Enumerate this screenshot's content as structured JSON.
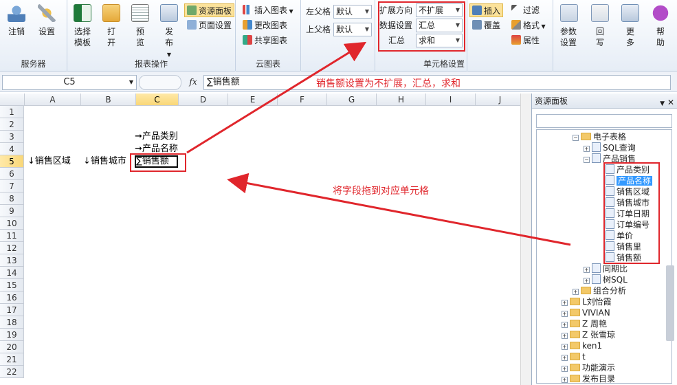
{
  "ribbon": {
    "groups": {
      "service": "服务器",
      "report_ops": "报表操作",
      "cloud": "云图表",
      "cell_settings": "单元格设置"
    },
    "cancel": "注销",
    "settings": "设置",
    "select_template": "选择模板",
    "open": "打开",
    "preview": "预览",
    "publish": "发布",
    "resource_panel": "资源面板",
    "page_setup": "页面设置",
    "insert_chart": "插入图表",
    "change_chart": "更改图表",
    "share_chart": "共享图表",
    "left_parent_label": "左父格",
    "left_parent_value": "默认",
    "top_parent_label": "上父格",
    "top_parent_value": "默认",
    "expand_dir_label": "扩展方向",
    "expand_dir_value": "不扩展",
    "data_setting_label": "数据设置",
    "data_setting_value": "汇总",
    "agg_label": "汇总",
    "agg_value": "求和",
    "insert": "插入",
    "cover": "覆盖",
    "filter": "过滤",
    "format": "格式",
    "property": "属性",
    "param_settings": "参数设置",
    "fill": "回写",
    "more": "更多",
    "help": "帮助"
  },
  "formula_bar": {
    "cell_ref": "C5",
    "fx": "fx",
    "formula": "∑销售额",
    "annotation": "销售额设置为不扩展，汇总，求和"
  },
  "sheet": {
    "columns": [
      "A",
      "B",
      "C",
      "D",
      "E",
      "F",
      "G",
      "H",
      "I",
      "J"
    ],
    "rows": [
      "1",
      "2",
      "3",
      "4",
      "5",
      "6",
      "7",
      "8",
      "9",
      "10",
      "11",
      "12",
      "13",
      "14",
      "15",
      "16",
      "17",
      "18",
      "19",
      "20",
      "21",
      "22"
    ],
    "c3": "➞产品类别",
    "c4": "➞产品名称",
    "a5": "↓销售区域",
    "b5": "↓销售城市",
    "c5": "∑销售额",
    "drag_annotation": "将字段拖到对应单元格"
  },
  "resource_panel": {
    "title": "资源面板",
    "tree": {
      "spreadsheet": "电子表格",
      "sql_query": "SQL查询",
      "product_sales": "产品销售",
      "fields": [
        "产品类别",
        "产品名称",
        "销售区域",
        "销售城市",
        "订单日期",
        "订单编号",
        "单价",
        "销售里",
        "销售额"
      ],
      "same_period": "同期比",
      "tree_sql": "树SQL",
      "combo_analysis": "组合分析",
      "folders": [
        "L刘怡霞",
        "VIVIAN",
        "Z 周艳",
        "Z 张雪琼",
        "ken1",
        "t",
        "功能演示",
        "发布目录"
      ]
    }
  },
  "colors": {
    "accent": "#e0262c",
    "selection": "#3399ff"
  }
}
